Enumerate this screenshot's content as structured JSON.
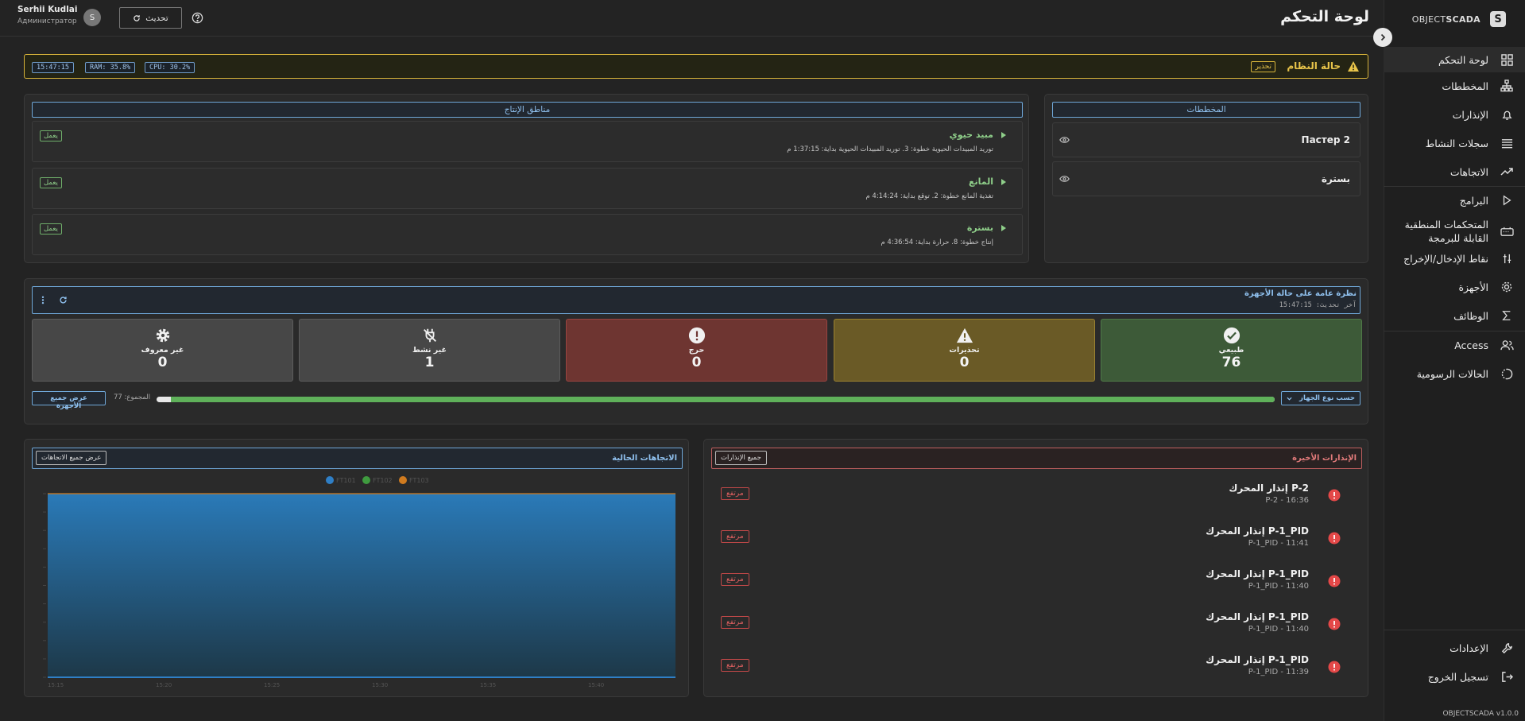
{
  "app": {
    "logo_text": "OBJECTSCADA",
    "logo_mark": "S",
    "version": "OBJECTSCADA v1.0.0"
  },
  "sidebar": {
    "items": [
      {
        "label": "لوحة التحكم",
        "icon": "dashboard-icon"
      },
      {
        "label": "المخططات",
        "icon": "diagram-icon"
      },
      {
        "label": "الإنذارات",
        "icon": "bell-icon"
      },
      {
        "label": "سجلات النشاط",
        "icon": "list-icon"
      },
      {
        "label": "الاتجاهات",
        "icon": "trend-icon"
      },
      {
        "label": "البرامج",
        "icon": "play-icon"
      },
      {
        "label": "المتحكمات المنطقية القابلة للبرمجة",
        "icon": "plc-icon"
      },
      {
        "label": "نقاط الإدخال/الإخراج",
        "icon": "io-icon"
      },
      {
        "label": "الأجهزة",
        "icon": "gear-icon"
      },
      {
        "label": "الوظائف",
        "icon": "sigma-icon"
      },
      {
        "label": "Access",
        "icon": "users-icon"
      },
      {
        "label": "الحالات الرسومية",
        "icon": "states-icon"
      }
    ],
    "bottom": [
      {
        "label": "الإعدادات",
        "icon": "wrench-icon"
      },
      {
        "label": "تسجيل الخروج",
        "icon": "logout-icon"
      }
    ]
  },
  "header": {
    "title": "لوحة التحكم",
    "user_name": "Serhii Kudlai",
    "user_role": "Администратор",
    "avatar_letter": "S",
    "refresh_label": "تحديث"
  },
  "system_status": {
    "title": "حالة النظام",
    "badge": "تحذير",
    "time": "15:47:15",
    "ram": "RAM: 35.8%",
    "cpu": "CPU: 30.2%"
  },
  "mnemo": {
    "title": "المخططات",
    "items": [
      "Пастер 2",
      "بسترة"
    ]
  },
  "zones": {
    "title": "مناطق الإنتاج",
    "items": [
      {
        "name": "مبيد حيوي",
        "detail": "توريد المبيدات الحيوية   خطوة: 3. توريد المبيدات الحيوية   بداية: 1:37:15 م",
        "status": "يعمل"
      },
      {
        "name": "المانع",
        "detail": "تغذية المانع   خطوة: 2. توقع   بداية: 4:14:24 م",
        "status": "يعمل"
      },
      {
        "name": "بسترة",
        "detail": "إنتاج   خطوة: 8. حرارة   بداية: 4:36:54 م",
        "status": "يعمل"
      }
    ]
  },
  "devices": {
    "title": "نظرة عامة على حالة الأجهزة",
    "updated": "آخر تحديث: 15:47:15",
    "cards": [
      {
        "label": "طبيعي",
        "value": "76",
        "color": "#3d5a38",
        "border": "#4f7a48",
        "icon": "check-circle-icon"
      },
      {
        "label": "تحذيرات",
        "value": "0",
        "color": "#6a5a26",
        "border": "#9b8230",
        "icon": "warning-icon"
      },
      {
        "label": "حرج",
        "value": "0",
        "color": "#6e3531",
        "border": "#994440",
        "icon": "error-circle-icon"
      },
      {
        "label": "غير نشط",
        "value": "1",
        "color": "#474747",
        "border": "#5c5c5c",
        "icon": "unplugged-icon"
      },
      {
        "label": "غير معروف",
        "value": "0",
        "color": "#474747",
        "border": "#5c5c5c",
        "icon": "gear-icon"
      }
    ],
    "group_by": "حسب نوع الجهاز",
    "total": "المجموع: 77",
    "show_all": "عرض جميع الأجهزة",
    "progress_normal_fraction": 0.987
  },
  "alarms": {
    "title": "الإنذارات الأخيرة",
    "all_button": "جميع الإنذارات",
    "items": [
      {
        "title": "إنذار المحرك P-2",
        "sub": "P-2 - 16:36",
        "level": "مرتفع"
      },
      {
        "title": "إنذار المحرك P-1_PID",
        "sub": "P-1_PID - 11:41",
        "level": "مرتفع"
      },
      {
        "title": "إنذار المحرك P-1_PID",
        "sub": "P-1_PID - 11:40",
        "level": "مرتفع"
      },
      {
        "title": "إنذار المحرك P-1_PID",
        "sub": "P-1_PID - 11:40",
        "level": "مرتفع"
      },
      {
        "title": "إنذار المحرك P-1_PID",
        "sub": "P-1_PID - 11:39",
        "level": "مرتفع"
      }
    ]
  },
  "trends": {
    "title": "الاتجاهات الحالية",
    "all_button": "عرض جميع الاتجاهات"
  },
  "chart_data": {
    "type": "area",
    "title": "",
    "series": [
      {
        "name": "FT101",
        "color": "#2f7fc6"
      },
      {
        "name": "FT102",
        "color": "#3f9b3f"
      },
      {
        "name": "FT103",
        "color": "#d07b1f"
      }
    ],
    "x": [
      "15:15",
      "15:20",
      "15:25",
      "15:30",
      "15:35",
      "15:40"
    ],
    "grid": false,
    "legend": "top-center"
  }
}
